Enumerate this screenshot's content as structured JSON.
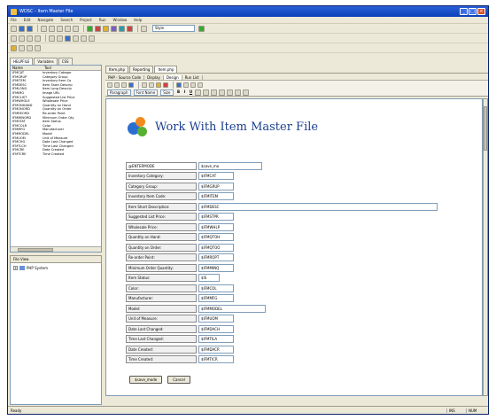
{
  "window": {
    "title": "WDSC - Item Master File"
  },
  "menubar": [
    "File",
    "Edit",
    "Navigate",
    "Search",
    "Project",
    "Run",
    "Window",
    "Help"
  ],
  "toolbar": {
    "style_combo": "Style"
  },
  "left_panel": {
    "tabs": [
      "HELPFILE",
      "Variables",
      "CSS"
    ],
    "columns": [
      "Name",
      "Tool"
    ],
    "rows": [
      [
        "IFMCAT",
        "Inventory Categor"
      ],
      [
        "IFMGRUP",
        "Category Group"
      ],
      [
        "IFMITEM",
        "Inventory Item Co"
      ],
      [
        "IFMDESC",
        "Item Short Descrip"
      ],
      [
        "IFMLONG",
        "Item Long Descrip"
      ],
      [
        "IFMIMG",
        "Image URL"
      ],
      [
        "IFMCLIST",
        "Suggested List Price"
      ],
      [
        "IFMWHOLE",
        "Wholesale Price"
      ],
      [
        "IFMONHAND",
        "Quantity on Hand"
      ],
      [
        "IFMONORD",
        "Quantity on Order"
      ],
      [
        "IFMREORD",
        "Re-order Point"
      ],
      [
        "IFMMINORD",
        "Minimum Order Qty"
      ],
      [
        "IFMSTAT",
        "Item Status"
      ],
      [
        "IFMCOLR",
        "Color"
      ],
      [
        "IFMMFG",
        "Manufacturer"
      ],
      [
        "IFMMODEL",
        "Model"
      ],
      [
        "IFMUOM",
        "Unit of Measure"
      ],
      [
        "IFMCHG",
        "Date Last Changed"
      ],
      [
        "IFMTLCH",
        "Time Last Changed"
      ],
      [
        "IFMCRE",
        "Date Created"
      ],
      [
        "IFMTCRE",
        "Time Created"
      ]
    ]
  },
  "file_view": {
    "title": "File View",
    "root": "PHP System"
  },
  "editor": {
    "doc_tabs": [
      "Item.php",
      "Reporting",
      "Item.php"
    ],
    "sub_tabs": [
      "PHP - Source Code",
      "Display",
      "Design",
      "Run List"
    ],
    "format": {
      "paragraph": "Paragraph",
      "font": "Font Name",
      "size": "Size"
    },
    "page_title": "Work With Item Master File",
    "header_row": {
      "label": "@ENTERMODE",
      "value": "$save_mo"
    },
    "fields": [
      {
        "label": "Inventory Category:",
        "value": "$IFMCAT"
      },
      {
        "label": "Category Group:",
        "value": "$IFMGRUP"
      },
      {
        "label": "Inventory Item Code:",
        "value": "$IFMITEM"
      },
      {
        "label": "Item Short Description:",
        "value": "$IFMDESC"
      },
      {
        "label": "Suggested List Price:",
        "value": "$IFMSTPR"
      },
      {
        "label": "Wholesale Price:",
        "value": "$IFMWHLP"
      },
      {
        "label": "Quantity on Hand:",
        "value": "$IFMQTOH"
      },
      {
        "label": "Quantity on Order:",
        "value": "$IFMQTOO"
      },
      {
        "label": "Re-order Point:",
        "value": "$IFMROPT"
      },
      {
        "label": "Minimum Order Quantity:",
        "value": "$IFMMINQ"
      },
      {
        "label": "Item Status:",
        "value": "$IS"
      },
      {
        "label": "Color:",
        "value": "$IFMCOL"
      },
      {
        "label": "Manufacturer:",
        "value": "$IFMMFG"
      },
      {
        "label": "Model:",
        "value": "$IFMMODEL"
      },
      {
        "label": "Unit of Measure:",
        "value": "$IFMUOM"
      },
      {
        "label": "Date Last Changed:",
        "value": "$IFMDACH"
      },
      {
        "label": "Time Last Changed:",
        "value": "$IFMTILA"
      },
      {
        "label": "Date Created:",
        "value": "$IFMDACR"
      },
      {
        "label": "Time Created:",
        "value": "$IFMTICR"
      }
    ],
    "buttons": {
      "save": "$save_mode",
      "cancel": "Cancel"
    }
  },
  "status": {
    "text": "Ready",
    "cell1": "INS",
    "cell2": "NUM"
  }
}
